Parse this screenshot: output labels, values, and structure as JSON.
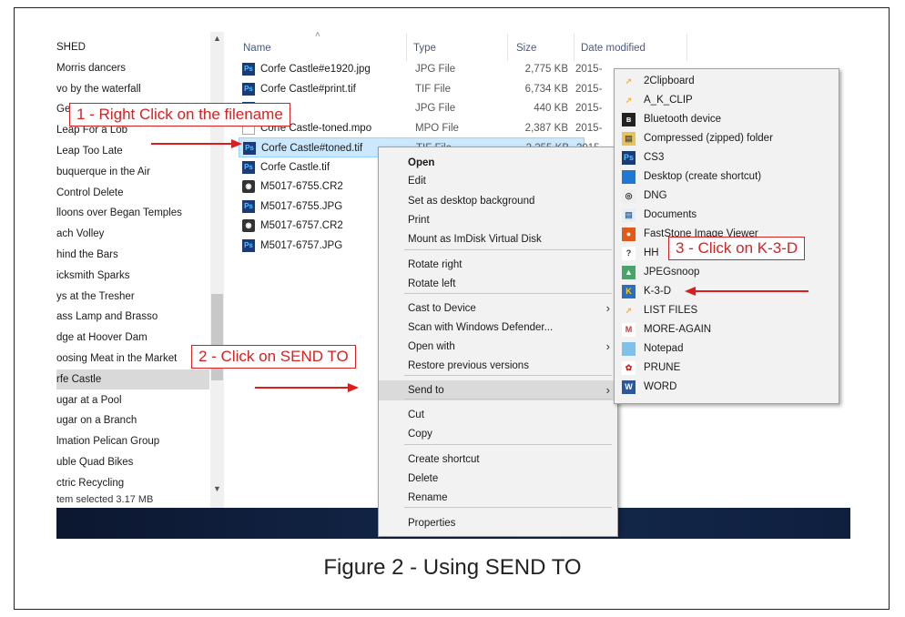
{
  "sidebar": {
    "items": [
      {
        "label": "SHED"
      },
      {
        "label": "Morris dancers"
      },
      {
        "label": "vo by the waterfall"
      },
      {
        "label": "Gen"
      },
      {
        "label": "Leap For a Lob"
      },
      {
        "label": "Leap Too Late"
      },
      {
        "label": "buquerque in the Air"
      },
      {
        "label": "Control Delete"
      },
      {
        "label": "lloons over Began Temples"
      },
      {
        "label": "ach Volley"
      },
      {
        "label": "hind the Bars"
      },
      {
        "label": "icksmith Sparks"
      },
      {
        "label": "ys at the Tresher"
      },
      {
        "label": "ass Lamp and Brasso"
      },
      {
        "label": "dge at Hoover Dam"
      },
      {
        "label": "oosing Meat in the Market"
      },
      {
        "label": "rfe Castle"
      },
      {
        "label": "ugar at a Pool"
      },
      {
        "label": "ugar on a Branch"
      },
      {
        "label": "lmation Pelican Group"
      },
      {
        "label": "uble Quad Bikes"
      },
      {
        "label": "ctric Recycling"
      }
    ],
    "selected_index": 16,
    "status": "tem selected  3.17 MB"
  },
  "columns": {
    "name": "Name",
    "type": "Type",
    "size": "Size",
    "date": "Date modified"
  },
  "files": [
    {
      "name": "Corfe Castle#e1920.jpg",
      "type": "JPG File",
      "size": "2,775 KB",
      "date": "2015-",
      "icon": "ps"
    },
    {
      "name": "Corfe Castle#print.tif",
      "type": "TIF File",
      "size": "6,734 KB",
      "date": "2015-",
      "icon": "ps"
    },
    {
      "name": "jpg",
      "type": "JPG File",
      "size": "440 KB",
      "date": "2015-",
      "icon": "ps"
    },
    {
      "name": "Corfe Castle-toned.mpo",
      "type": "MPO File",
      "size": "2,387 KB",
      "date": "2015-",
      "icon": "doc"
    },
    {
      "name": "Corfe Castle#toned.tif",
      "type": "TIF File",
      "size": "2,255 KB",
      "date": "2015-",
      "icon": "ps"
    },
    {
      "name": "Corfe Castle.tif",
      "type": "",
      "size": "",
      "date": "",
      "icon": "ps"
    },
    {
      "name": "M5017-6755.CR2",
      "type": "",
      "size": "",
      "date": "",
      "icon": "cam"
    },
    {
      "name": "M5017-6755.JPG",
      "type": "",
      "size": "",
      "date": "",
      "icon": "ps"
    },
    {
      "name": "M5017-6757.CR2",
      "type": "",
      "size": "",
      "date": "",
      "icon": "cam"
    },
    {
      "name": "M5017-6757.JPG",
      "type": "",
      "size": "",
      "date": "",
      "icon": "ps"
    }
  ],
  "selected_file_index": 4,
  "context_menu": {
    "items": [
      "Open",
      "Edit",
      "Set as desktop background",
      "Print",
      "Mount as ImDisk Virtual Disk",
      "Rotate right",
      "Rotate left",
      "Cast to Device",
      "Scan with Windows Defender...",
      "Open with",
      "Restore previous versions",
      "Send to",
      "Cut",
      "Copy",
      "Create shortcut",
      "Delete",
      "Rename",
      "Properties"
    ]
  },
  "send_to_menu": {
    "items": [
      {
        "label": "2Clipboard",
        "icon": "folder-arrow-icon"
      },
      {
        "label": "A_K_CLIP",
        "icon": "folder-arrow-icon"
      },
      {
        "label": "Bluetooth device",
        "icon": "bluetooth-icon"
      },
      {
        "label": "Compressed (zipped) folder",
        "icon": "zip-folder-icon"
      },
      {
        "label": "CS3",
        "icon": "photoshop-icon"
      },
      {
        "label": "Desktop (create shortcut)",
        "icon": "desktop-icon"
      },
      {
        "label": "DNG",
        "icon": "dng-icon"
      },
      {
        "label": "Documents",
        "icon": "documents-icon"
      },
      {
        "label": "FastStone Image Viewer",
        "icon": "faststone-icon"
      },
      {
        "label": "HH",
        "icon": "help-icon"
      },
      {
        "label": "JPEGsnoop",
        "icon": "jpegsnoop-icon"
      },
      {
        "label": "K-3-D",
        "icon": "k3d-icon"
      },
      {
        "label": "LIST FILES",
        "icon": "folder-arrow-icon"
      },
      {
        "label": "MORE-AGAIN",
        "icon": "more-again-icon"
      },
      {
        "label": "Notepad",
        "icon": "notepad-icon"
      },
      {
        "label": "PRUNE",
        "icon": "prune-icon"
      },
      {
        "label": "WORD",
        "icon": "word-icon"
      }
    ]
  },
  "callouts": {
    "step1": "1 - Right Click on the filename",
    "step2": "2 - Click on SEND TO",
    "step3": "3 - Click on K-3-D"
  },
  "caption": "Figure 2 - Using SEND TO",
  "colors": {
    "callout": "#d62222",
    "selection": "#cce8ff",
    "taskbar": "#14294d"
  }
}
